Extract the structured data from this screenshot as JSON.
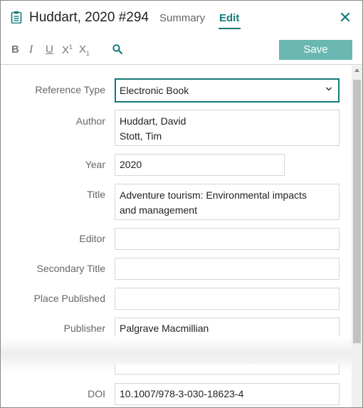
{
  "header": {
    "title": "Huddart, 2020 #294",
    "tabs": [
      {
        "label": "Summary",
        "active": false
      },
      {
        "label": "Edit",
        "active": true
      }
    ],
    "accent_color": "#127a78"
  },
  "toolbar": {
    "bold": "B",
    "italic": "I",
    "underline": "U",
    "superscript": "X",
    "superscript_mark": "1",
    "subscript": "X",
    "subscript_mark": "1",
    "search_icon": "search-icon",
    "save_label": "Save",
    "save_color": "#6bb7b1"
  },
  "form": {
    "reference_type": {
      "label": "Reference Type",
      "value": "Electronic Book"
    },
    "author": {
      "label": "Author",
      "line1": "Huddart, David",
      "line2": "Stott, Tim"
    },
    "year": {
      "label": "Year",
      "value": "2020"
    },
    "title": {
      "label": "Title",
      "line1": "Adventure tourism: Environmental impacts",
      "line2": "and management"
    },
    "editor": {
      "label": "Editor",
      "value": ""
    },
    "secondary_title": {
      "label": "Secondary Title",
      "value": ""
    },
    "place_published": {
      "label": "Place Published",
      "value": ""
    },
    "publisher": {
      "label": "Publisher",
      "value": "Palgrave Macmillian"
    },
    "doi": {
      "label": "DOI",
      "value": "10.1007/978-3-030-18623-4"
    }
  }
}
